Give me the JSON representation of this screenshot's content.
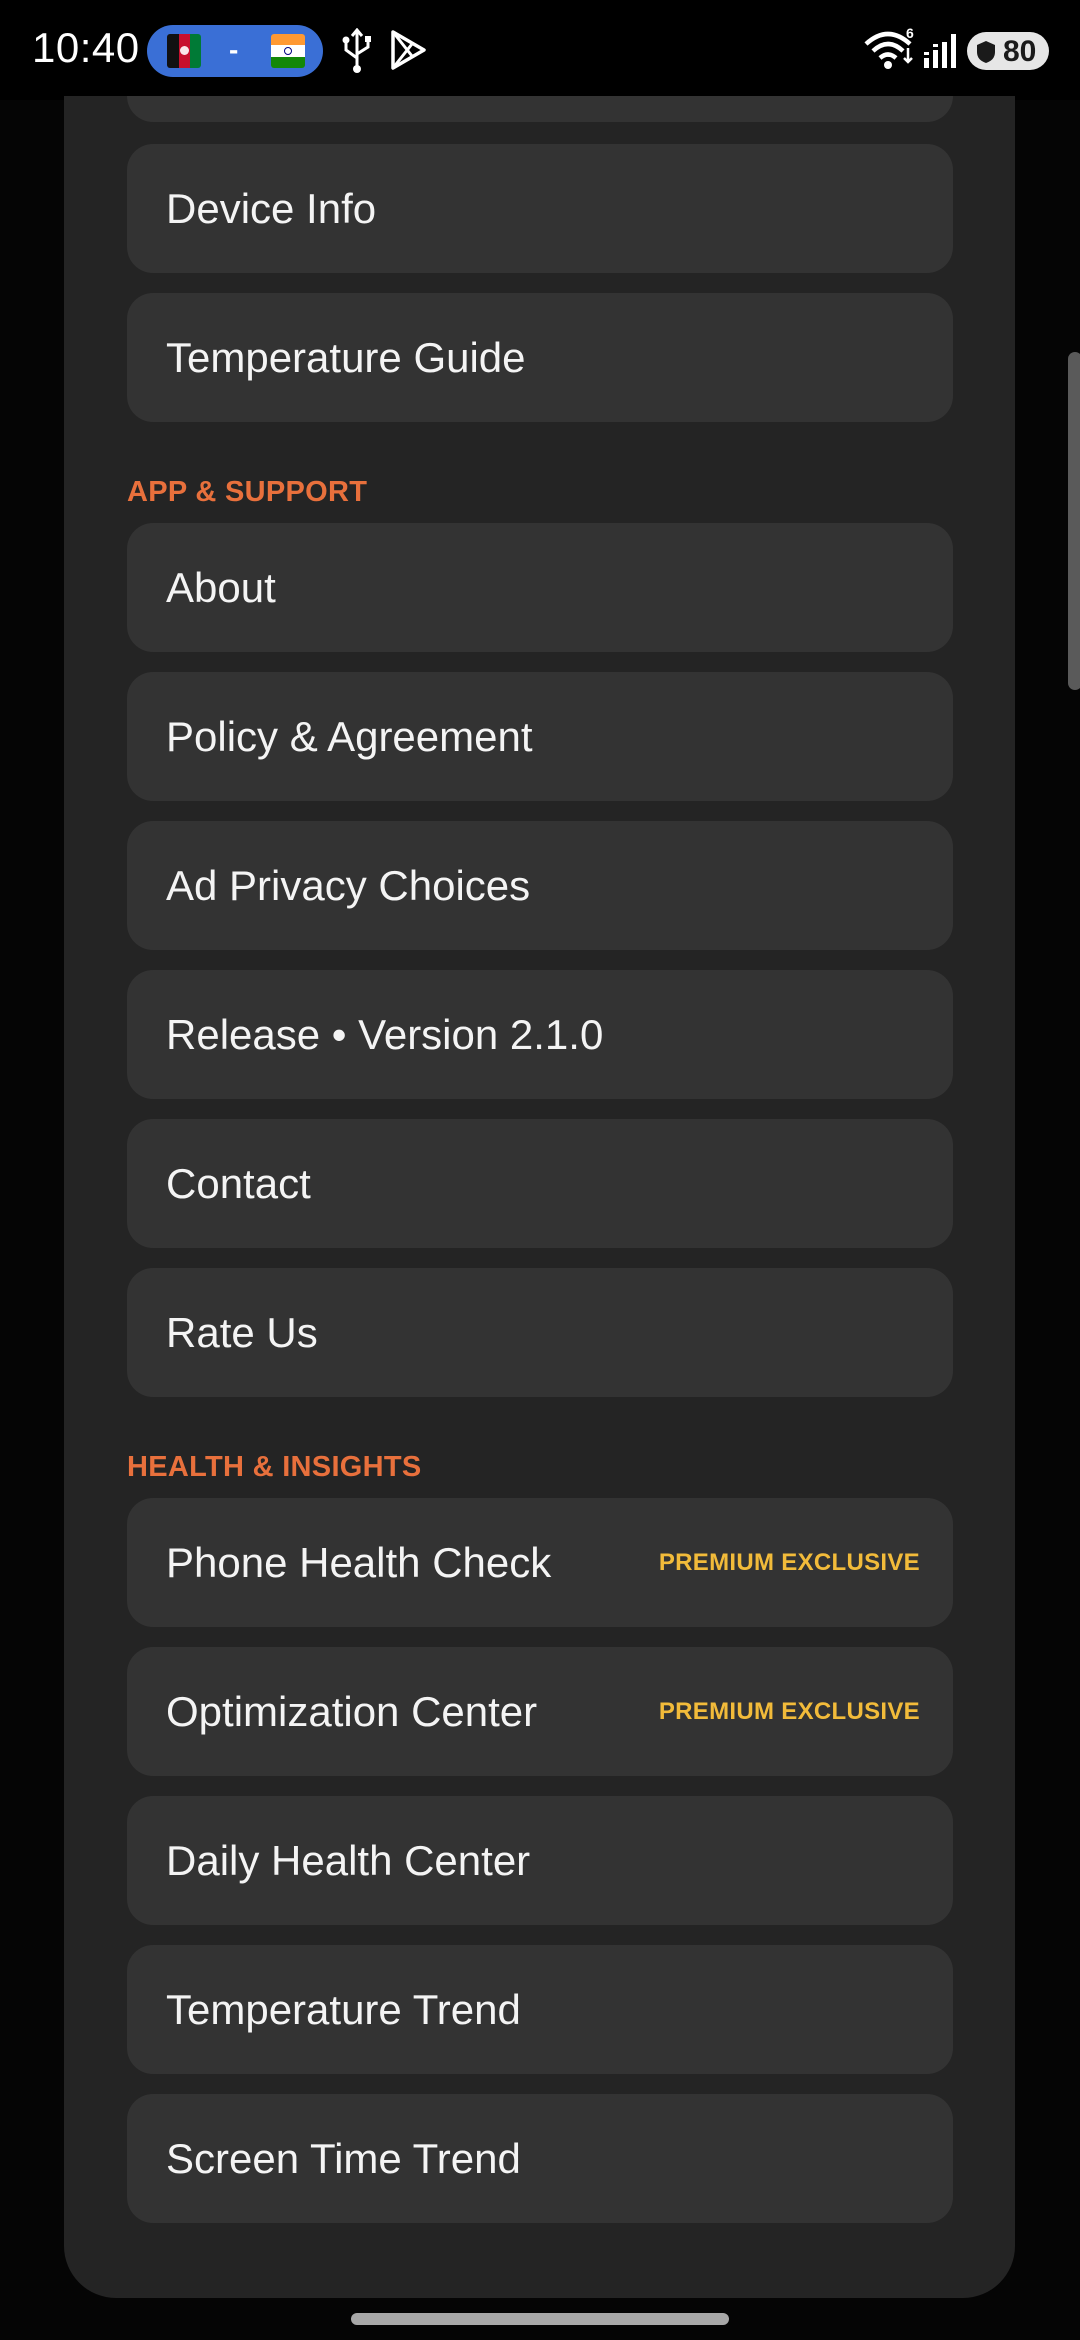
{
  "status_bar": {
    "time": "10:40",
    "flag_separator": "-",
    "battery_level": "80",
    "wifi_badge": "6"
  },
  "sections": {
    "device_items": [
      {
        "label": "Device Info"
      },
      {
        "label": "Temperature Guide"
      }
    ],
    "app_support": {
      "title": "APP & SUPPORT",
      "items": [
        {
          "label": "About"
        },
        {
          "label": "Policy & Agreement"
        },
        {
          "label": "Ad Privacy Choices"
        },
        {
          "label": "Release • Version 2.1.0"
        },
        {
          "label": "Contact"
        },
        {
          "label": "Rate Us"
        }
      ]
    },
    "health_insights": {
      "title": "HEALTH & INSIGHTS",
      "items": [
        {
          "label": "Phone Health Check",
          "badge": "PREMIUM EXCLUSIVE"
        },
        {
          "label": "Optimization Center",
          "badge": "PREMIUM EXCLUSIVE"
        },
        {
          "label": "Daily Health Center"
        },
        {
          "label": "Temperature Trend"
        },
        {
          "label": "Screen Time Trend"
        }
      ]
    }
  },
  "colors": {
    "section_title": "#e8703c",
    "premium_badge": "#f2bb3a",
    "card_background": "#333333",
    "sheet_background": "#242424"
  }
}
